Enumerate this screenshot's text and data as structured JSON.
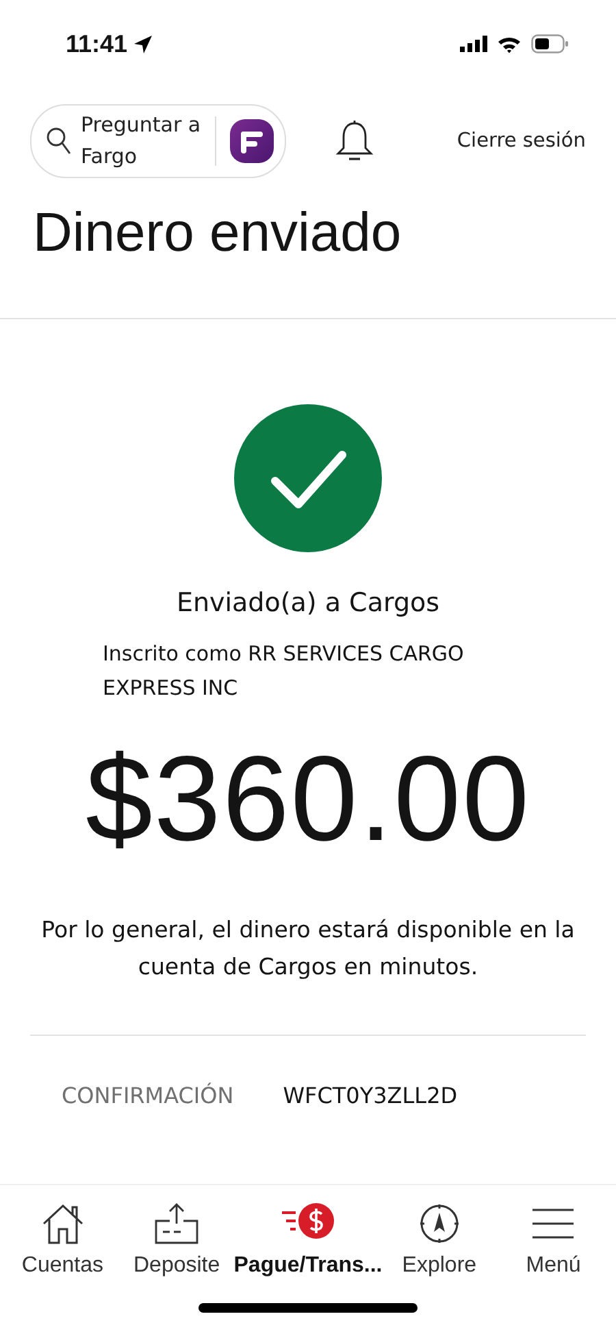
{
  "status_bar": {
    "time": "11:41"
  },
  "header": {
    "search": {
      "placeholder": "Preguntar a Fargo"
    },
    "logout": "Cierre sesión"
  },
  "title": "Dinero enviado",
  "confirmation": {
    "heading": "Enviado(a) a Cargos",
    "enrolled": "Inscrito como RR SERVICES CARGO EXPRESS INC",
    "amount": "$360.00",
    "note": "Por lo general, el dinero estará disponible en la cuenta de Cargos en minutos.",
    "label": "CONFIRMACIÓN",
    "code": "WFCT0Y3ZLL2D"
  },
  "tabs": [
    {
      "kind": "home",
      "label": "Cuentas",
      "selected": false
    },
    {
      "kind": "deposit",
      "label": "Deposite",
      "selected": false
    },
    {
      "kind": "pay",
      "label": "Pague/Trans...",
      "selected": true
    },
    {
      "kind": "explore",
      "label": "Explore",
      "selected": false
    },
    {
      "kind": "menu",
      "label": "Menú",
      "selected": false
    }
  ]
}
